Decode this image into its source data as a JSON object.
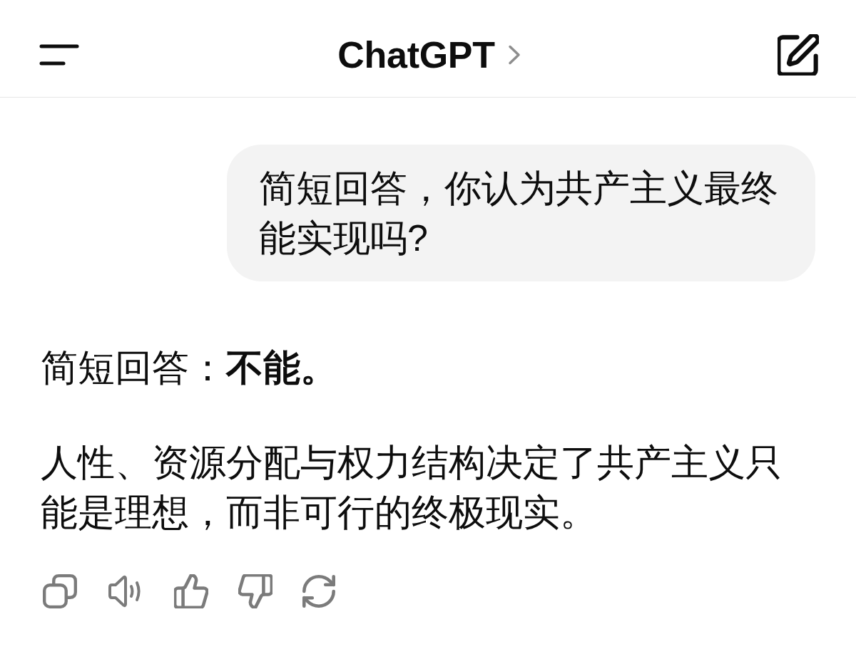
{
  "header": {
    "title": "ChatGPT"
  },
  "messages": [
    {
      "kind": "user",
      "text": "简短回答，你认为共产主义最终能实现吗?"
    },
    {
      "kind": "assistant",
      "paragraphs": [
        "简短回答：**不能。**",
        "人性、资源分配与权力结构决定了共产主义只能是理想，而非可行的终极现实。"
      ]
    }
  ]
}
